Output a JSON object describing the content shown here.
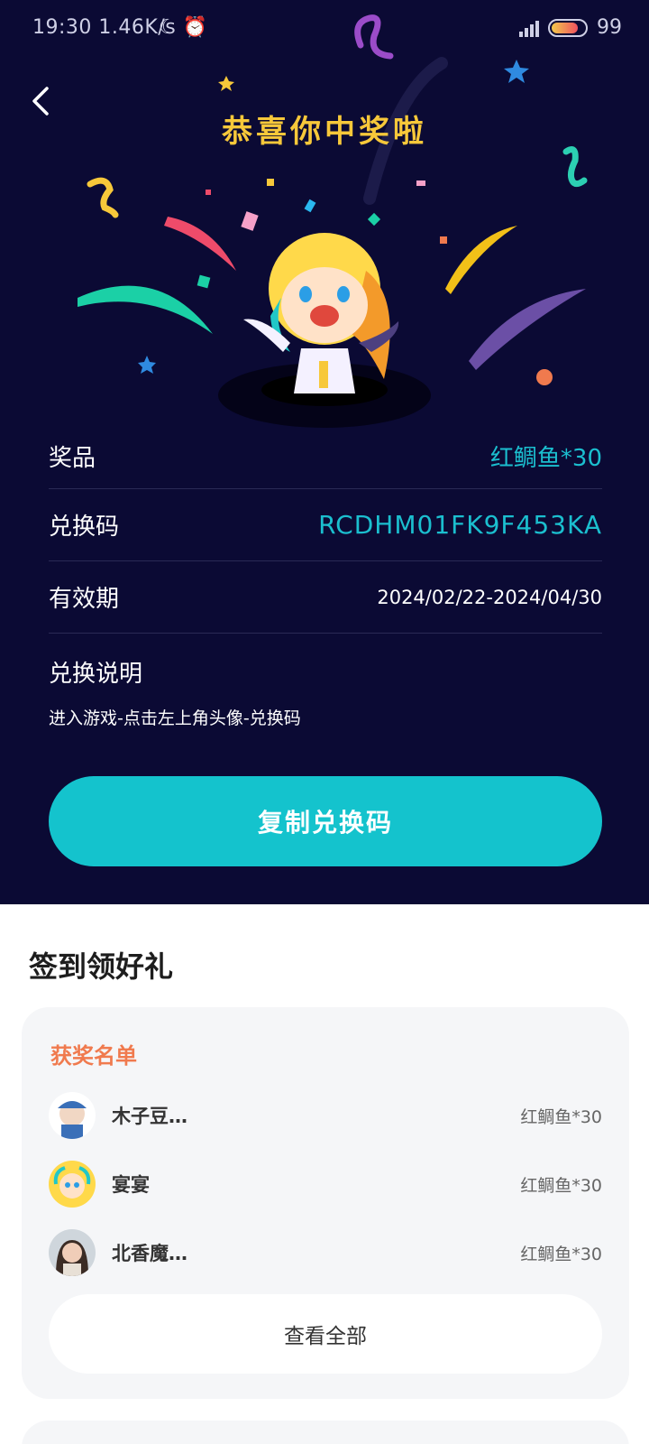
{
  "status_bar": {
    "time": "19:30 1.46K/s",
    "battery": "99"
  },
  "header": {
    "title": "恭喜你中奖啦"
  },
  "prize": {
    "prize_label": "奖品",
    "prize_value": "红鲷鱼*30",
    "code_label": "兑换码",
    "code_value": "RCDHM01FK9F453KA",
    "validity_label": "有效期",
    "validity_value": "2024/02/22-2024/04/30",
    "instructions_label": "兑换说明",
    "instructions_text": "进入游戏-点击左上角头像-兑换码"
  },
  "copy_button": {
    "label": "复制兑换码"
  },
  "signin_section": {
    "title": "签到领好礼",
    "winners_title": "获奖名单",
    "winners": [
      {
        "name": "木子豆…",
        "prize": "红鲷鱼*30"
      },
      {
        "name": "宴宴",
        "prize": "红鲷鱼*30"
      },
      {
        "name": "北香魔…",
        "prize": "红鲷鱼*30"
      }
    ],
    "view_all_label": "查看全部"
  },
  "colors": {
    "dark_bg": "#0b0a34",
    "accent_cyan": "#14c3cd",
    "title_yellow": "#f7c83a",
    "winners_orange": "#f07a4e"
  }
}
